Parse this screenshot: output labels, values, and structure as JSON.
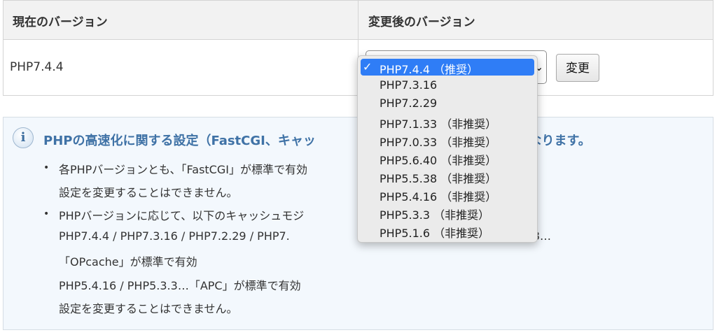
{
  "version_table": {
    "header_current": "現在のバージョン",
    "header_after": "変更後のバージョン",
    "current_version": "PHP7.4.4",
    "change_button": "変更"
  },
  "version_dropdown": {
    "check_mark": "✓",
    "selected": "PHP7.4.4 （推奨）",
    "options": [
      "PHP7.4.4 （推奨）",
      "PHP7.3.16",
      "PHP7.2.29",
      "PHP7.1.33 （非推奨）",
      "PHP7.0.33 （非推奨）",
      "PHP5.6.40 （非推奨）",
      "PHP5.5.38 （非推奨）",
      "PHP5.4.16 （非推奨）",
      "PHP5.3.3 （非推奨）",
      "PHP5.1.6 （非推奨）"
    ]
  },
  "info": {
    "icon": "info-icon",
    "title": "PHPの高速化に関する設定（FastCGI、キャッ                                        有効になります。",
    "bullet_glyph": "•",
    "lines": [
      "各PHPバージョンとも、「FastCGI」が標準で有効",
      "設定を変更することはできません。",
      "PHPバージョンに応じて、以下のキャッシュモジ                                              す。",
      "PHP7.4.4 / PHP7.3.16 / PHP7.2.29 / PHP7.                                            5.40 / PHP5.5.38…",
      "「OPcache」が標準で有効",
      "PHP5.4.16 / PHP5.3.3…「APC」が標準で有効",
      "設定を変更することはできません。"
    ]
  },
  "colors": {
    "accent_title": "#3f72a6",
    "selection": "#2f7df6",
    "info_background": "#f3f8fd"
  }
}
